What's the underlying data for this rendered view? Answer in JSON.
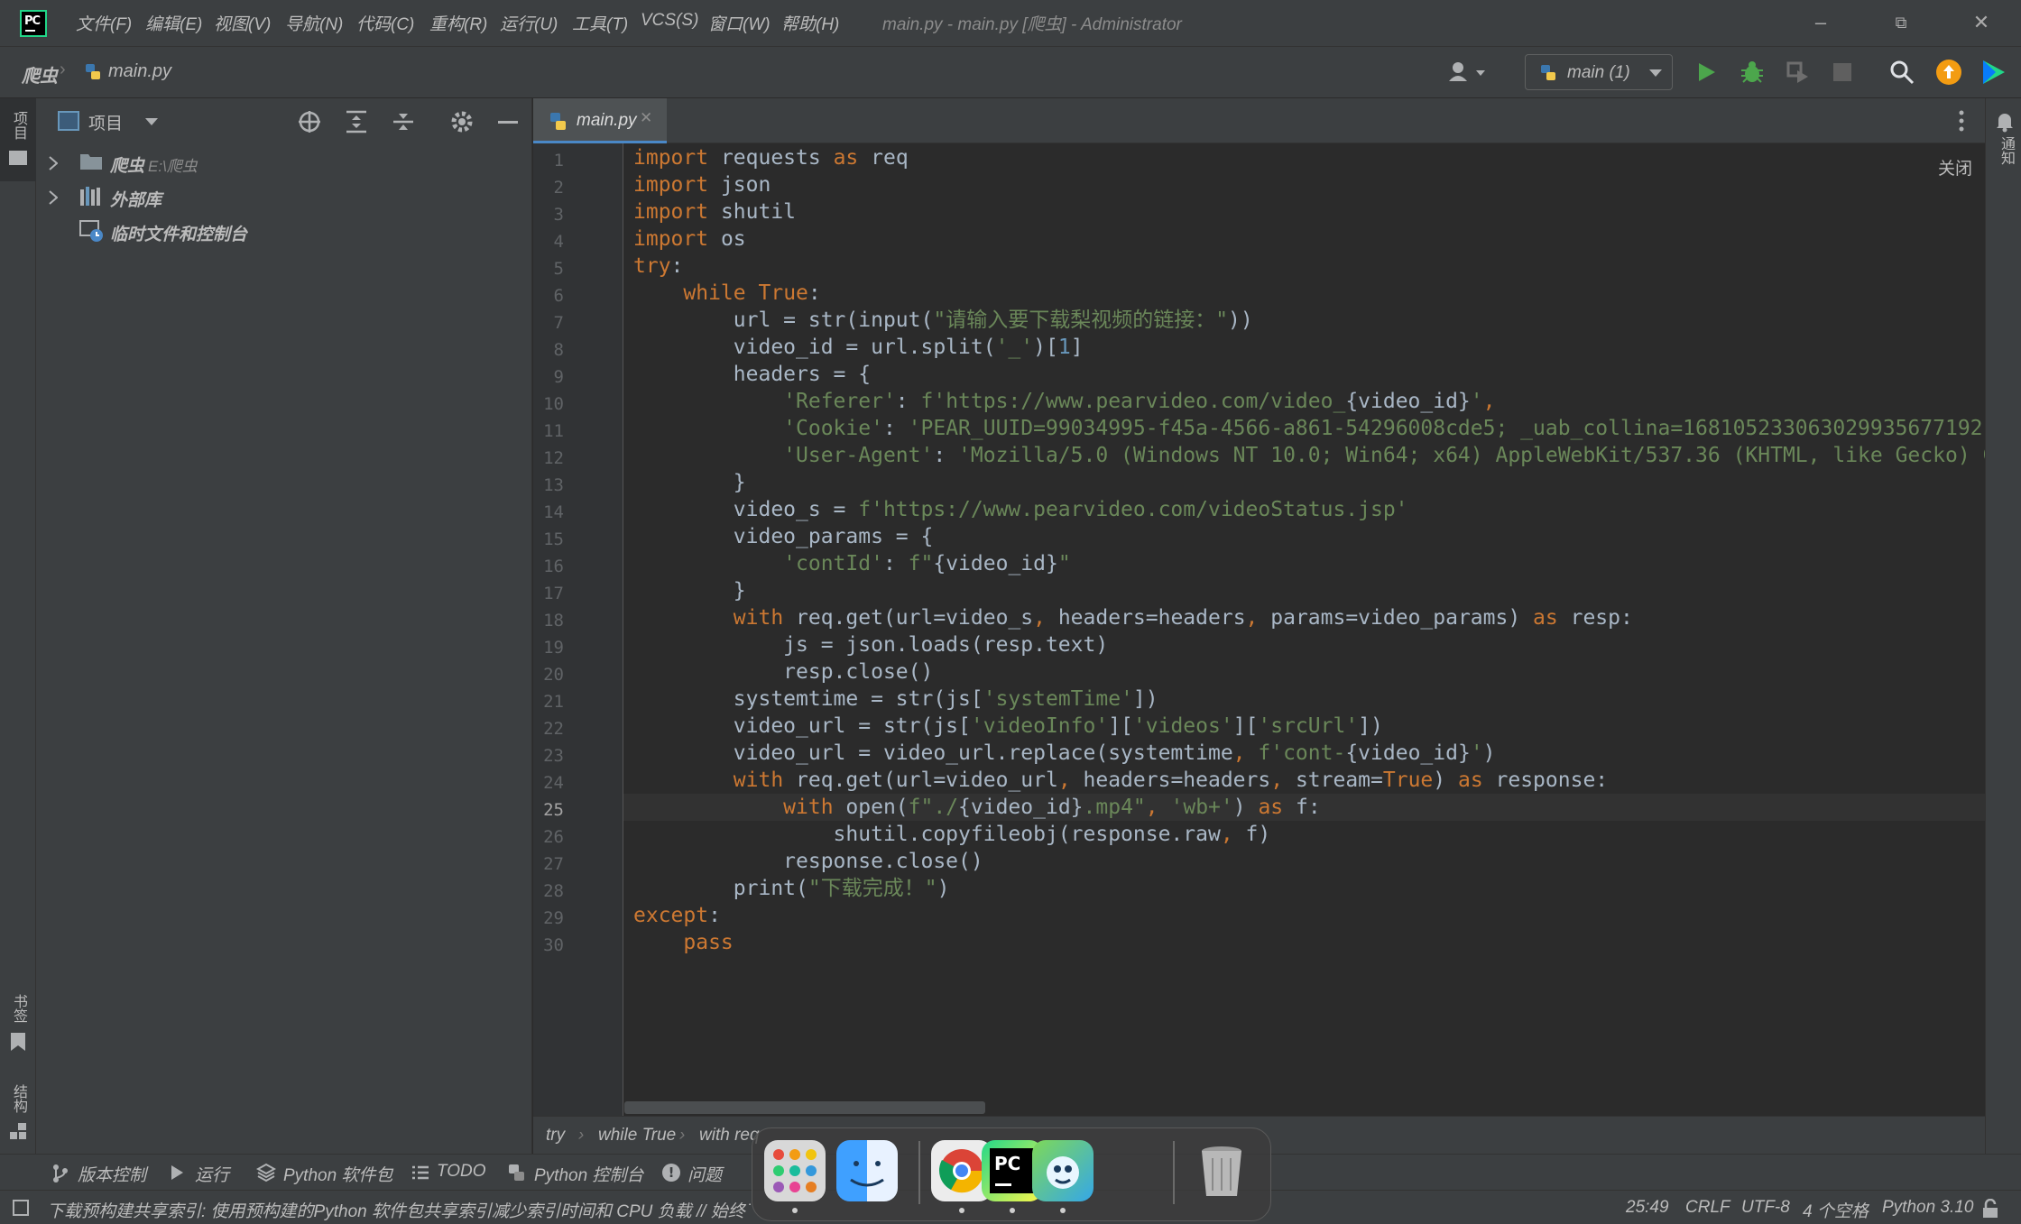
{
  "app": {
    "logo_text": "PC"
  },
  "menu": [
    "文件(F)",
    "编辑(E)",
    "视图(V)",
    "导航(N)",
    "代码(C)",
    "重构(R)",
    "运行(U)",
    "工具(T)",
    "VCS(S)",
    "窗口(W)",
    "帮助(H)"
  ],
  "window_title": "main.py - main.py [爬虫] - Administrator",
  "navbar": {
    "project": "爬虫",
    "file": "main.py",
    "run_config": "main (1)"
  },
  "left_stripe": {
    "project": "项目",
    "bookmarks": "书签",
    "structure": "结构"
  },
  "project_panel": {
    "title": "项目",
    "tree": [
      {
        "label": "爬虫",
        "hint": "E:\\爬虫"
      },
      {
        "label": "外部库",
        "hint": ""
      },
      {
        "label": "临时文件和控制台",
        "hint": ""
      }
    ]
  },
  "editor": {
    "tab": "main.py",
    "close_label": "关闭",
    "line_numbers": [
      "1",
      "2",
      "3",
      "4",
      "5",
      "6",
      "7",
      "8",
      "9",
      "10",
      "11",
      "12",
      "13",
      "14",
      "15",
      "16",
      "17",
      "18",
      "19",
      "20",
      "21",
      "22",
      "23",
      "24",
      "25",
      "26",
      "27",
      "28",
      "29",
      "30"
    ],
    "lines": [
      [
        {
          "t": "import",
          "c": "kw"
        },
        {
          "t": " requests ",
          "c": ""
        },
        {
          "t": "as",
          "c": "kw"
        },
        {
          "t": " req",
          "c": ""
        }
      ],
      [
        {
          "t": "import",
          "c": "kw"
        },
        {
          "t": " json",
          "c": ""
        }
      ],
      [
        {
          "t": "import",
          "c": "kw"
        },
        {
          "t": " shutil",
          "c": ""
        }
      ],
      [
        {
          "t": "import",
          "c": "kw"
        },
        {
          "t": " os",
          "c": ""
        }
      ],
      [
        {
          "t": "try",
          "c": "kw"
        },
        {
          "t": ":",
          "c": ""
        }
      ],
      [
        {
          "t": "    ",
          "c": ""
        },
        {
          "t": "while",
          "c": "kw"
        },
        {
          "t": " ",
          "c": ""
        },
        {
          "t": "True",
          "c": "kw"
        },
        {
          "t": ":",
          "c": ""
        }
      ],
      [
        {
          "t": "        url = str(input(",
          "c": ""
        },
        {
          "t": "\"请输入要下载梨视频的链接：\"",
          "c": "st"
        },
        {
          "t": "))",
          "c": ""
        }
      ],
      [
        {
          "t": "        video_id = url.split(",
          "c": ""
        },
        {
          "t": "'_'",
          "c": "st"
        },
        {
          "t": ")[",
          "c": ""
        },
        {
          "t": "1",
          "c": "nm"
        },
        {
          "t": "]",
          "c": ""
        }
      ],
      [
        {
          "t": "        headers = {",
          "c": ""
        }
      ],
      [
        {
          "t": "            ",
          "c": ""
        },
        {
          "t": "'Referer'",
          "c": "st"
        },
        {
          "t": ": ",
          "c": ""
        },
        {
          "t": "f'https://www.pearvideo.com/video_",
          "c": "st"
        },
        {
          "t": "{video_id}",
          "c": ""
        },
        {
          "t": "'",
          "c": "st"
        },
        {
          "t": ",",
          "c": "kw"
        }
      ],
      [
        {
          "t": "            ",
          "c": ""
        },
        {
          "t": "'Cookie'",
          "c": "st"
        },
        {
          "t": ": ",
          "c": ""
        },
        {
          "t": "'PEAR_UUID=99034995-f45a-4566-a861-54296008cde5; _uab_collina=168105233063029935677192",
          "c": "st"
        }
      ],
      [
        {
          "t": "            ",
          "c": ""
        },
        {
          "t": "'User-Agent'",
          "c": "st"
        },
        {
          "t": ": ",
          "c": ""
        },
        {
          "t": "'Mozilla/5.0 (Windows NT 10.0; Win64; x64) AppleWebKit/537.36 (KHTML, like Gecko) C",
          "c": "st"
        }
      ],
      [
        {
          "t": "        }",
          "c": ""
        }
      ],
      [
        {
          "t": "        video_s = ",
          "c": ""
        },
        {
          "t": "f'https://www.pearvideo.com/videoStatus.jsp'",
          "c": "st"
        }
      ],
      [
        {
          "t": "        video_params = {",
          "c": ""
        }
      ],
      [
        {
          "t": "            ",
          "c": ""
        },
        {
          "t": "'contId'",
          "c": "st"
        },
        {
          "t": ": ",
          "c": ""
        },
        {
          "t": "f\"",
          "c": "st"
        },
        {
          "t": "{video_id}",
          "c": ""
        },
        {
          "t": "\"",
          "c": "st"
        }
      ],
      [
        {
          "t": "        }",
          "c": ""
        }
      ],
      [
        {
          "t": "        ",
          "c": ""
        },
        {
          "t": "with",
          "c": "kw"
        },
        {
          "t": " req.get(url=video_s",
          "c": ""
        },
        {
          "t": ",",
          "c": "kw"
        },
        {
          "t": " headers=headers",
          "c": ""
        },
        {
          "t": ",",
          "c": "kw"
        },
        {
          "t": " params=video_params) ",
          "c": ""
        },
        {
          "t": "as",
          "c": "kw"
        },
        {
          "t": " resp:",
          "c": ""
        }
      ],
      [
        {
          "t": "            js = json.loads(resp.text)",
          "c": ""
        }
      ],
      [
        {
          "t": "            resp.close()",
          "c": ""
        }
      ],
      [
        {
          "t": "        systemtime = str(js[",
          "c": ""
        },
        {
          "t": "'systemTime'",
          "c": "st"
        },
        {
          "t": "])",
          "c": ""
        }
      ],
      [
        {
          "t": "        video_url = str(js[",
          "c": ""
        },
        {
          "t": "'videoInfo'",
          "c": "st"
        },
        {
          "t": "][",
          "c": ""
        },
        {
          "t": "'videos'",
          "c": "st"
        },
        {
          "t": "][",
          "c": ""
        },
        {
          "t": "'srcUrl'",
          "c": "st"
        },
        {
          "t": "])",
          "c": ""
        }
      ],
      [
        {
          "t": "        video_url = video_url.replace(systemtime",
          "c": ""
        },
        {
          "t": ",",
          "c": "kw"
        },
        {
          "t": " ",
          "c": ""
        },
        {
          "t": "f'cont-",
          "c": "st"
        },
        {
          "t": "{video_id}",
          "c": ""
        },
        {
          "t": "'",
          "c": "st"
        },
        {
          "t": ")",
          "c": ""
        }
      ],
      [
        {
          "t": "        ",
          "c": ""
        },
        {
          "t": "with",
          "c": "kw"
        },
        {
          "t": " req.get(url=video_url",
          "c": ""
        },
        {
          "t": ",",
          "c": "kw"
        },
        {
          "t": " headers=headers",
          "c": ""
        },
        {
          "t": ",",
          "c": "kw"
        },
        {
          "t": " stream=",
          "c": ""
        },
        {
          "t": "True",
          "c": "kw"
        },
        {
          "t": ") ",
          "c": ""
        },
        {
          "t": "as",
          "c": "kw"
        },
        {
          "t": " response:",
          "c": ""
        }
      ],
      [
        {
          "t": "            ",
          "c": ""
        },
        {
          "t": "with",
          "c": "kw"
        },
        {
          "t": " open(",
          "c": ""
        },
        {
          "t": "f\"./",
          "c": "st"
        },
        {
          "t": "{video_id}",
          "c": ""
        },
        {
          "t": ".mp4\"",
          "c": "st"
        },
        {
          "t": ",",
          "c": "kw"
        },
        {
          "t": " ",
          "c": ""
        },
        {
          "t": "'wb+'",
          "c": "st"
        },
        {
          "t": ") ",
          "c": ""
        },
        {
          "t": "as",
          "c": "kw"
        },
        {
          "t": " f:",
          "c": ""
        }
      ],
      [
        {
          "t": "                shutil.copyfileobj(response.raw",
          "c": ""
        },
        {
          "t": ",",
          "c": "kw"
        },
        {
          "t": " f)",
          "c": ""
        }
      ],
      [
        {
          "t": "            response.close()",
          "c": ""
        }
      ],
      [
        {
          "t": "        print(",
          "c": ""
        },
        {
          "t": "\"下载完成！\"",
          "c": "st"
        },
        {
          "t": ")",
          "c": ""
        }
      ],
      [
        {
          "t": "except",
          "c": "kw"
        },
        {
          "t": ":",
          "c": ""
        }
      ],
      [
        {
          "t": "    ",
          "c": ""
        },
        {
          "t": "pass",
          "c": "kw"
        }
      ]
    ],
    "current_line": 25
  },
  "breadcrumbs": [
    "try",
    "while True",
    "with req"
  ],
  "tool_windows": [
    "版本控制",
    "运行",
    "Python 软件包",
    "TODO",
    "Python 控制台",
    "问题"
  ],
  "status": {
    "message": "下载预构建共享索引: 使用预构建的Python 软件包共享索引减少索引时间和 CPU 负载 // 始终下载 // 下载",
    "position": "25:49",
    "line_sep": "CRLF",
    "encoding": "UTF-8",
    "indent": "4 个空格",
    "interpreter": "Python 3.10"
  },
  "right_stripe": {
    "notifications": "通知"
  },
  "dock": {
    "apps": [
      "launchpad-icon",
      "finder-icon",
      "chrome-icon",
      "pycharm-icon",
      "app-icon",
      "trash-icon"
    ]
  },
  "colors": {
    "accent": "#4a88c7",
    "keyword": "#cc7832",
    "string": "#6a8759",
    "number": "#6897bb",
    "run": "#4ca64c"
  }
}
